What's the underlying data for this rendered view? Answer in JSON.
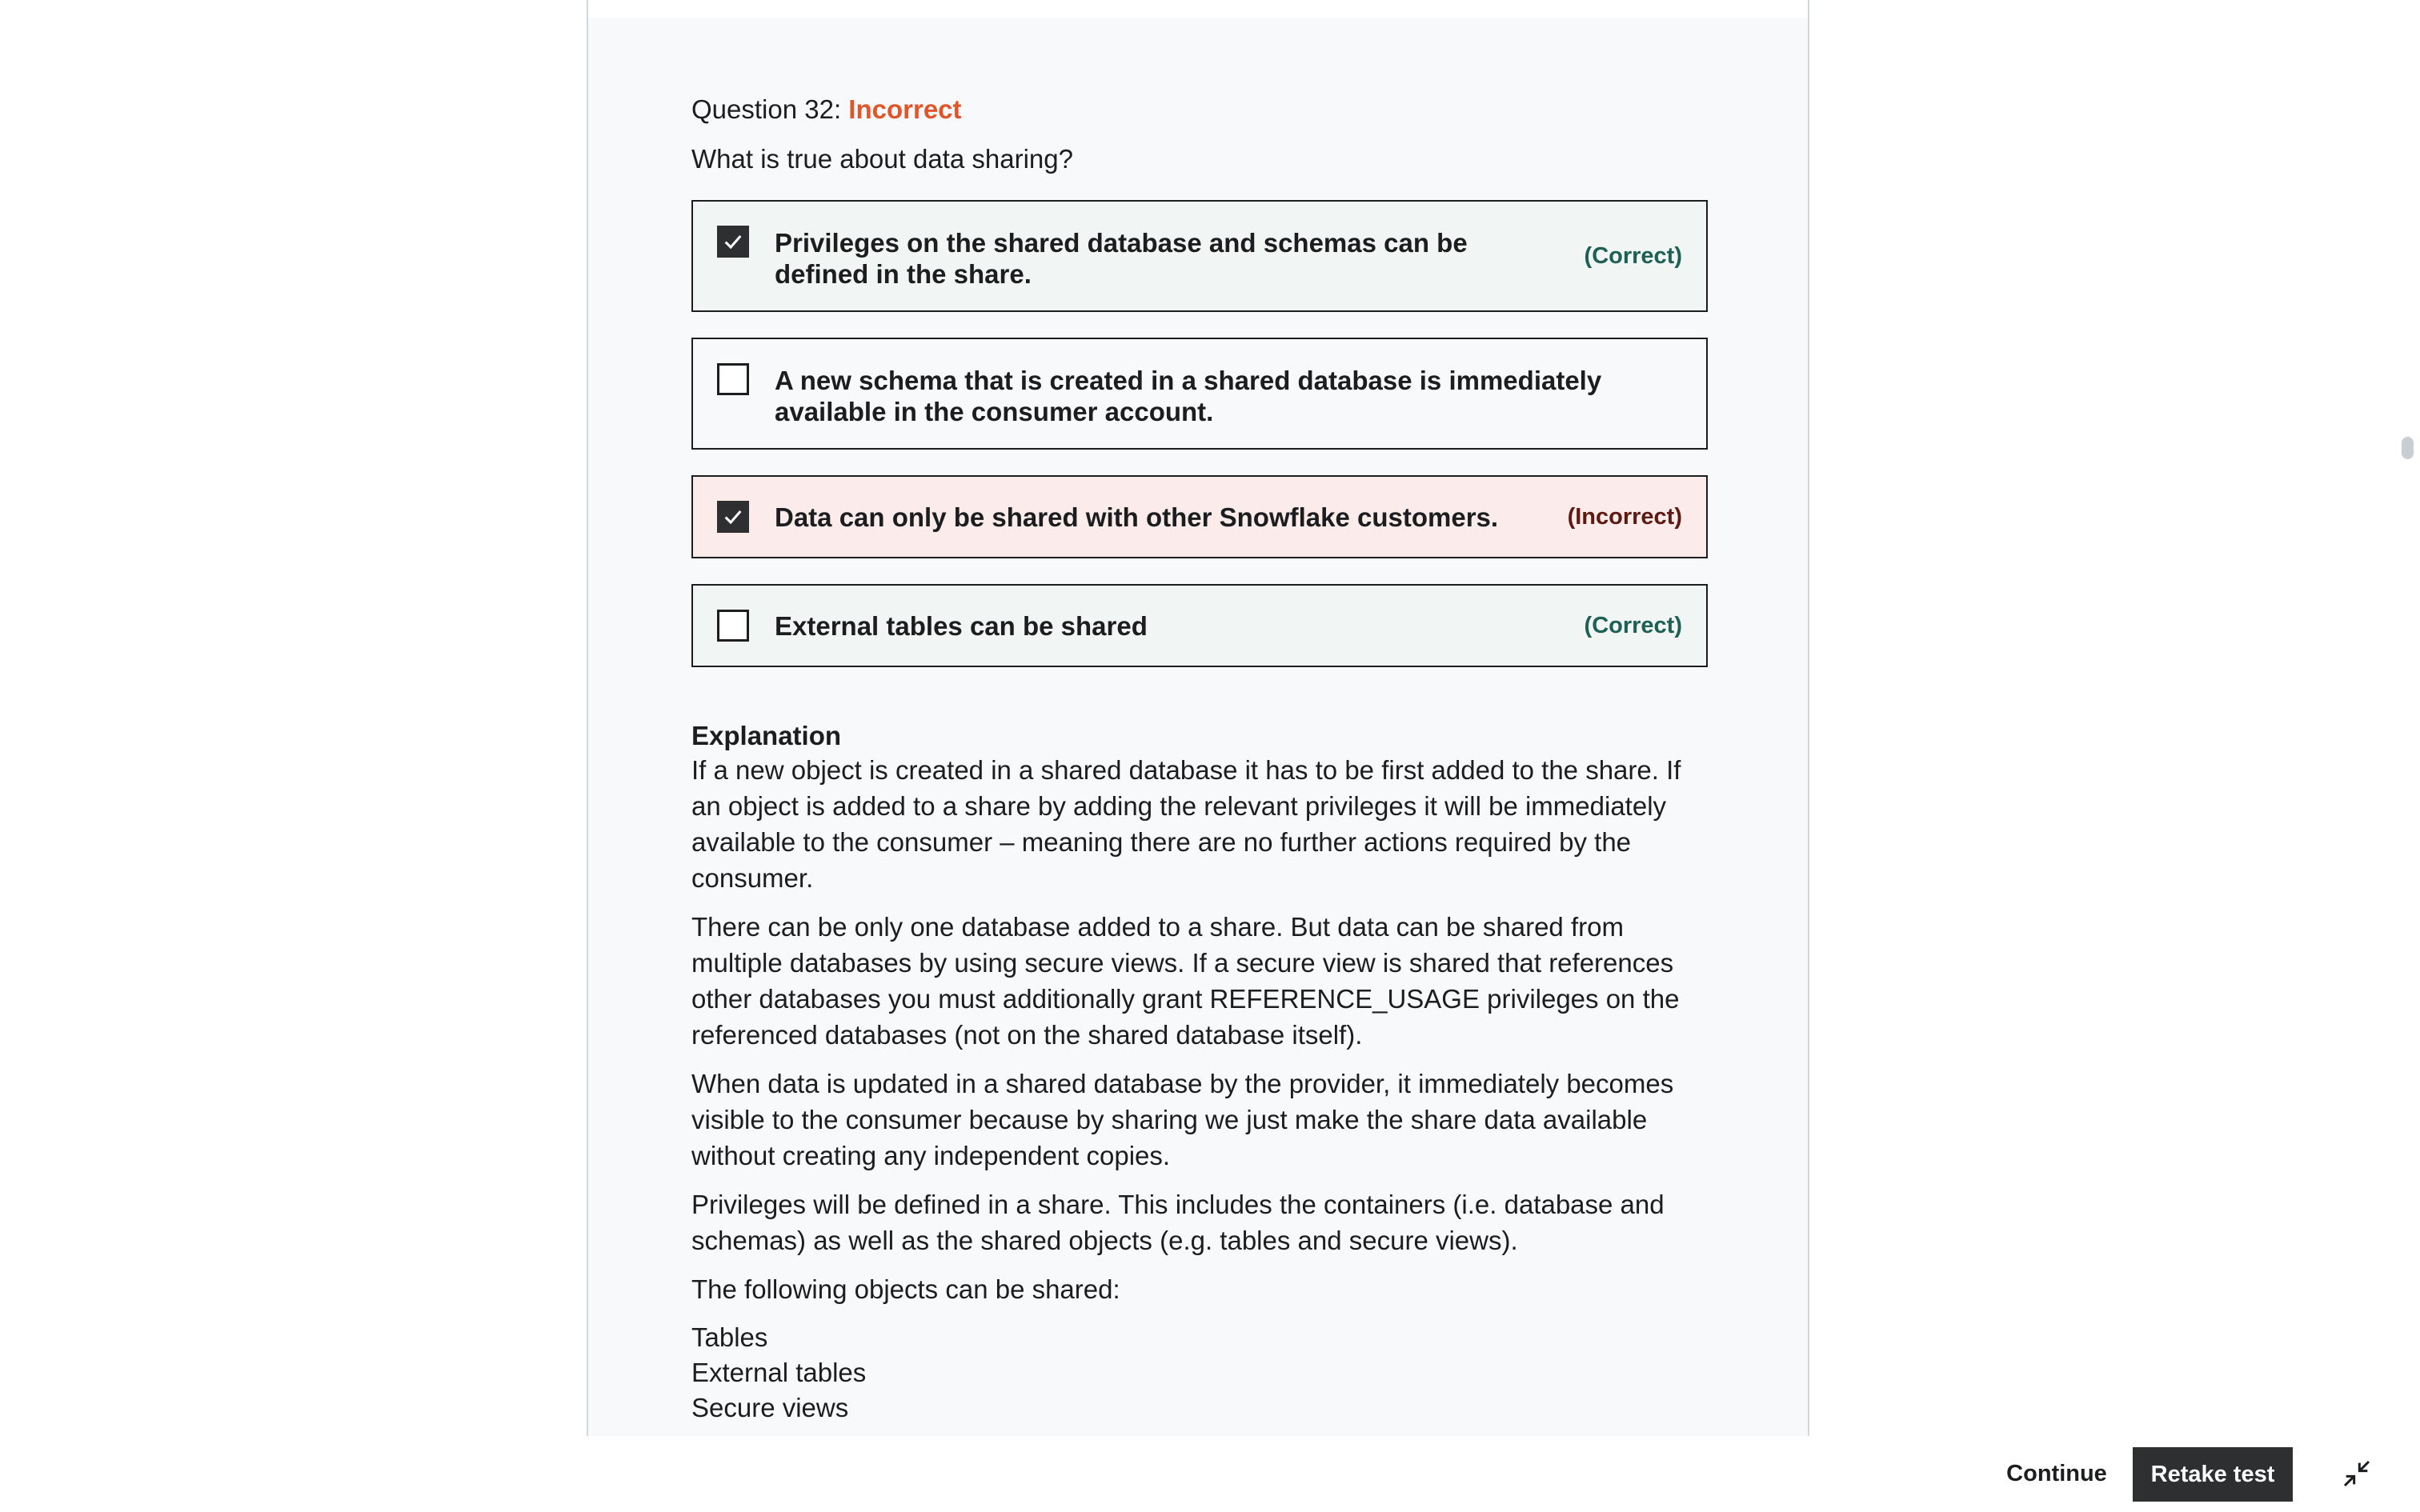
{
  "question": {
    "header_label": "Question 32:",
    "status": "Incorrect",
    "prompt": "What is true about data sharing?"
  },
  "answers": [
    {
      "text": "Privileges on the shared database and schemas can be defined in the share.",
      "checked": true,
      "mark": "(Correct)"
    },
    {
      "text": "A new schema that is created in a shared database is immediately available in the consumer account.",
      "checked": false,
      "mark": ""
    },
    {
      "text": "Data can only be shared with other Snowflake customers.",
      "checked": true,
      "mark": "(Incorrect)"
    },
    {
      "text": "External tables can be shared",
      "checked": false,
      "mark": "(Correct)"
    }
  ],
  "explanation": {
    "title": "Explanation",
    "paragraphs": [
      "If a new object is created in a shared database it has to be first added to the share. If an object is added to a share by adding the relevant privileges it will be immediately available to the consumer – meaning there are no further actions required by the consumer.",
      "There can be only one database added to a share. But data can be shared from multiple databases by using secure views. If a secure view is shared that references other databases you must additionally grant REFERENCE_USAGE privileges on the referenced databases (not on the shared database itself).",
      "When data is updated in a shared database by the provider, it immediately becomes visible to the consumer because by sharing we just make the share data available without creating any independent copies.",
      "Privileges will be defined in a share. This includes the containers (i.e. database and schemas) as well as the shared objects (e.g. tables and secure views).",
      "The following objects can be shared:"
    ],
    "list": [
      "Tables",
      "External tables",
      "Secure views"
    ]
  },
  "footer": {
    "continue_label": "Continue",
    "retake_label": "Retake test"
  },
  "icons": {
    "checkmark": "check-icon",
    "collapse": "collapse-icon"
  },
  "colors": {
    "incorrect_status": "#e0562b",
    "correct_mark": "#1e6055",
    "incorrect_mark": "#5e1a12",
    "incorrect_bg": "#fbeceb",
    "correct_bg": "#f1f5f4",
    "dark_button": "#2d2f31"
  }
}
